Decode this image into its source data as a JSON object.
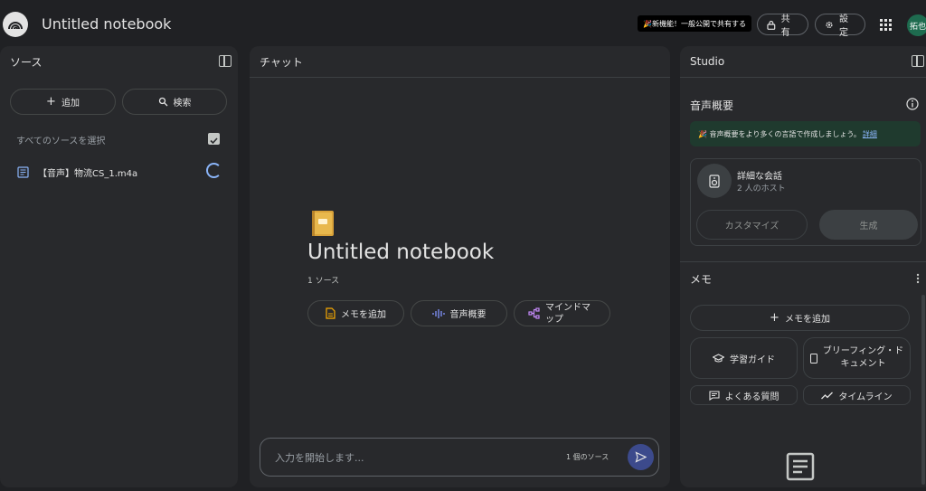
{
  "header": {
    "title": "Untitled notebook",
    "promo": "🎉新機能！一般公開で共有する",
    "share_label": "共有",
    "settings_label": "設定",
    "avatar_initials": "拓也"
  },
  "sources": {
    "title": "ソース",
    "add_label": "追加",
    "search_label": "検索",
    "select_all_label": "すべてのソースを選択",
    "items": [
      {
        "name": "【音声】物流CS_1.m4a"
      }
    ]
  },
  "chat": {
    "title": "チャット",
    "notebook_title": "Untitled notebook",
    "source_count": "1 ソース",
    "chips": [
      {
        "label": "メモを追加"
      },
      {
        "label": "音声概要"
      },
      {
        "label": "マインドマップ"
      }
    ],
    "input_placeholder": "入力を開始します...",
    "input_source_count": "1 個のソース"
  },
  "studio": {
    "title": "Studio",
    "audio_overview_title": "音声概要",
    "banner_text": "🎉 音声概要をより多くの言語で作成しましょう。",
    "banner_link": "詳細",
    "card_title": "詳細な会話",
    "card_subtitle": "2 人のホスト",
    "customize_label": "カスタマイズ",
    "generate_label": "生成",
    "memo_title": "メモ",
    "add_memo_label": "メモを追加",
    "memo_buttons": [
      {
        "label": "学習ガイド"
      },
      {
        "label": "ブリーフィング・ドキュメント"
      },
      {
        "label": "よくある質問"
      },
      {
        "label": "タイムライン"
      }
    ]
  },
  "colors": {
    "background": "#202124",
    "panel": "#28292c",
    "accent": "#8ab4f8",
    "banner": "#1f3a2e"
  }
}
